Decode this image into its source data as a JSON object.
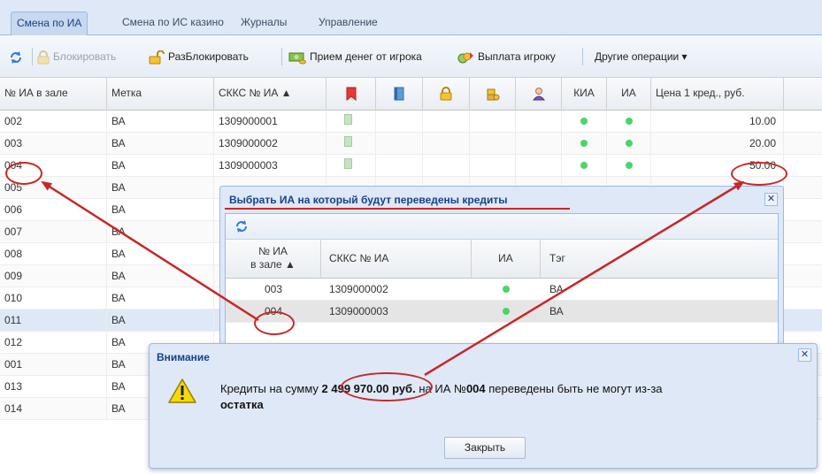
{
  "tabs": [
    {
      "label": "Смена по ИА"
    },
    {
      "label": "Смена по ИС казино"
    },
    {
      "label": "Журналы"
    },
    {
      "label": "Управление"
    }
  ],
  "toolbar": {
    "refresh_icon": "refresh-icon",
    "block_label": "Блокировать",
    "unblock_label": "РазБлокировать",
    "accept_money_label": "Прием денег от игрока",
    "payout_label": "Выплата игроку",
    "other_label": "Другие операции ▾"
  },
  "grid": {
    "columns": [
      "№ ИА в зале",
      "Метка",
      "СККС № ИА ▲",
      "",
      "",
      "",
      "",
      "",
      "КИА",
      "ИА",
      "Цена 1 кред., руб."
    ],
    "header_icons": [
      "bookmark-icon",
      "book-icon",
      "lock-icon",
      "coins-icon",
      "user-icon"
    ],
    "rows": [
      {
        "num": "002",
        "tag": "ВА",
        "skks": "1309000001",
        "flag": true,
        "kia": true,
        "ia": true,
        "price": "10.00"
      },
      {
        "num": "003",
        "tag": "ВА",
        "skks": "1309000002",
        "flag": true,
        "kia": true,
        "ia": true,
        "price": "20.00"
      },
      {
        "num": "004",
        "tag": "ВА",
        "skks": "1309000003",
        "flag": true,
        "kia": true,
        "ia": true,
        "price": "50.00"
      },
      {
        "num": "005",
        "tag": "ВА",
        "skks": "",
        "flag": false,
        "kia": false,
        "ia": false,
        "price": ""
      },
      {
        "num": "006",
        "tag": "ВА",
        "skks": "",
        "flag": false,
        "kia": false,
        "ia": false,
        "price": ""
      },
      {
        "num": "007",
        "tag": "ВА",
        "skks": "",
        "flag": false,
        "kia": false,
        "ia": false,
        "price": ""
      },
      {
        "num": "008",
        "tag": "ВА",
        "skks": "",
        "flag": false,
        "kia": false,
        "ia": false,
        "price": ""
      },
      {
        "num": "009",
        "tag": "ВА",
        "skks": "",
        "flag": false,
        "kia": false,
        "ia": false,
        "price": ""
      },
      {
        "num": "010",
        "tag": "ВА",
        "skks": "",
        "flag": false,
        "kia": false,
        "ia": false,
        "price": ""
      },
      {
        "num": "011",
        "tag": "ВА",
        "skks": "",
        "flag": false,
        "kia": false,
        "ia": false,
        "price": ""
      },
      {
        "num": "012",
        "tag": "ВА",
        "skks": "",
        "flag": false,
        "kia": false,
        "ia": false,
        "price": ""
      },
      {
        "num": "001",
        "tag": "ВА",
        "skks": "",
        "flag": false,
        "kia": false,
        "ia": false,
        "price": ""
      },
      {
        "num": "013",
        "tag": "ВА",
        "skks": "",
        "flag": false,
        "kia": false,
        "ia": false,
        "price": ""
      },
      {
        "num": "014",
        "tag": "ВА",
        "skks": "",
        "flag": false,
        "kia": false,
        "ia": false,
        "price": ""
      }
    ]
  },
  "select_window": {
    "title": "Выбрать ИА на который будут переведены кредиты",
    "close_glyph": "✕",
    "col_num_line1": "№ ИА",
    "col_num_line2": "в зале ▲",
    "col_skks": "СККС № ИА",
    "col_ia": "ИА",
    "col_tag": "Тэг",
    "rows": [
      {
        "num": "003",
        "skks": "1309000002",
        "tag": "ВА"
      },
      {
        "num": "004",
        "skks": "1309000003",
        "tag": "ВА"
      }
    ]
  },
  "alert": {
    "title": "Внимание",
    "close_glyph": "✕",
    "icon": "warning-icon",
    "msg_prefix": "Кредиты на сумму",
    "amount": "2 499 970.00",
    "currency": "руб.",
    "msg_middle": "на ИА №",
    "machine_no": "004",
    "msg_suffix": "переведены быть не могут из-за",
    "msg_end": "остатка",
    "button_label": "Закрыть"
  },
  "colors": {
    "accent": "#15428b",
    "annotation": "#c62828",
    "status_green": "#4bd468",
    "warning_yellow": "#f5d90a"
  }
}
